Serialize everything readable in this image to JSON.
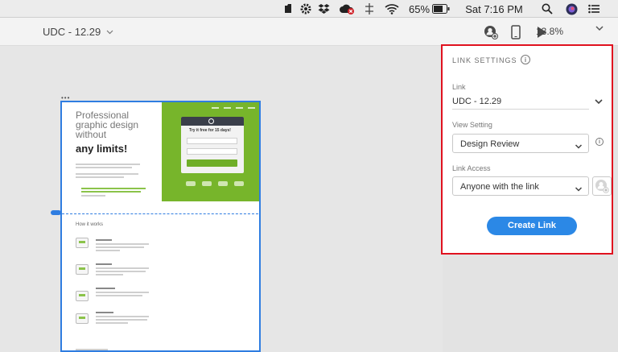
{
  "menubar": {
    "battery_percent": "65%",
    "clock": "Sat 7:16 PM",
    "icons": [
      "evernote-icon",
      "gear-icon",
      "dropbox-icon",
      "creative-cloud-icon",
      "network-icon",
      "wifi-icon",
      "battery-icon",
      "search-icon",
      "siri-icon",
      "menu-icon"
    ]
  },
  "toolbar": {
    "document_title": "UDC - 12.29",
    "zoom": "13.8%",
    "icons": [
      "share-user-icon",
      "device-preview-icon",
      "play-icon",
      "chevron-down-icon"
    ]
  },
  "artboard": {
    "hero_title": "Professional graphic design without",
    "hero_strong": "any limits!",
    "form_title": "Try it free for 15 days!",
    "section_title": "How it works"
  },
  "link_settings": {
    "title": "LINK SETTINGS",
    "info_glyph": "i",
    "link_label": "Link",
    "link_value": "UDC - 12.29",
    "view_setting_label": "View Setting",
    "view_setting_value": "Design Review",
    "link_access_label": "Link Access",
    "link_access_value": "Anyone with the link",
    "create_button": "Create Link"
  }
}
